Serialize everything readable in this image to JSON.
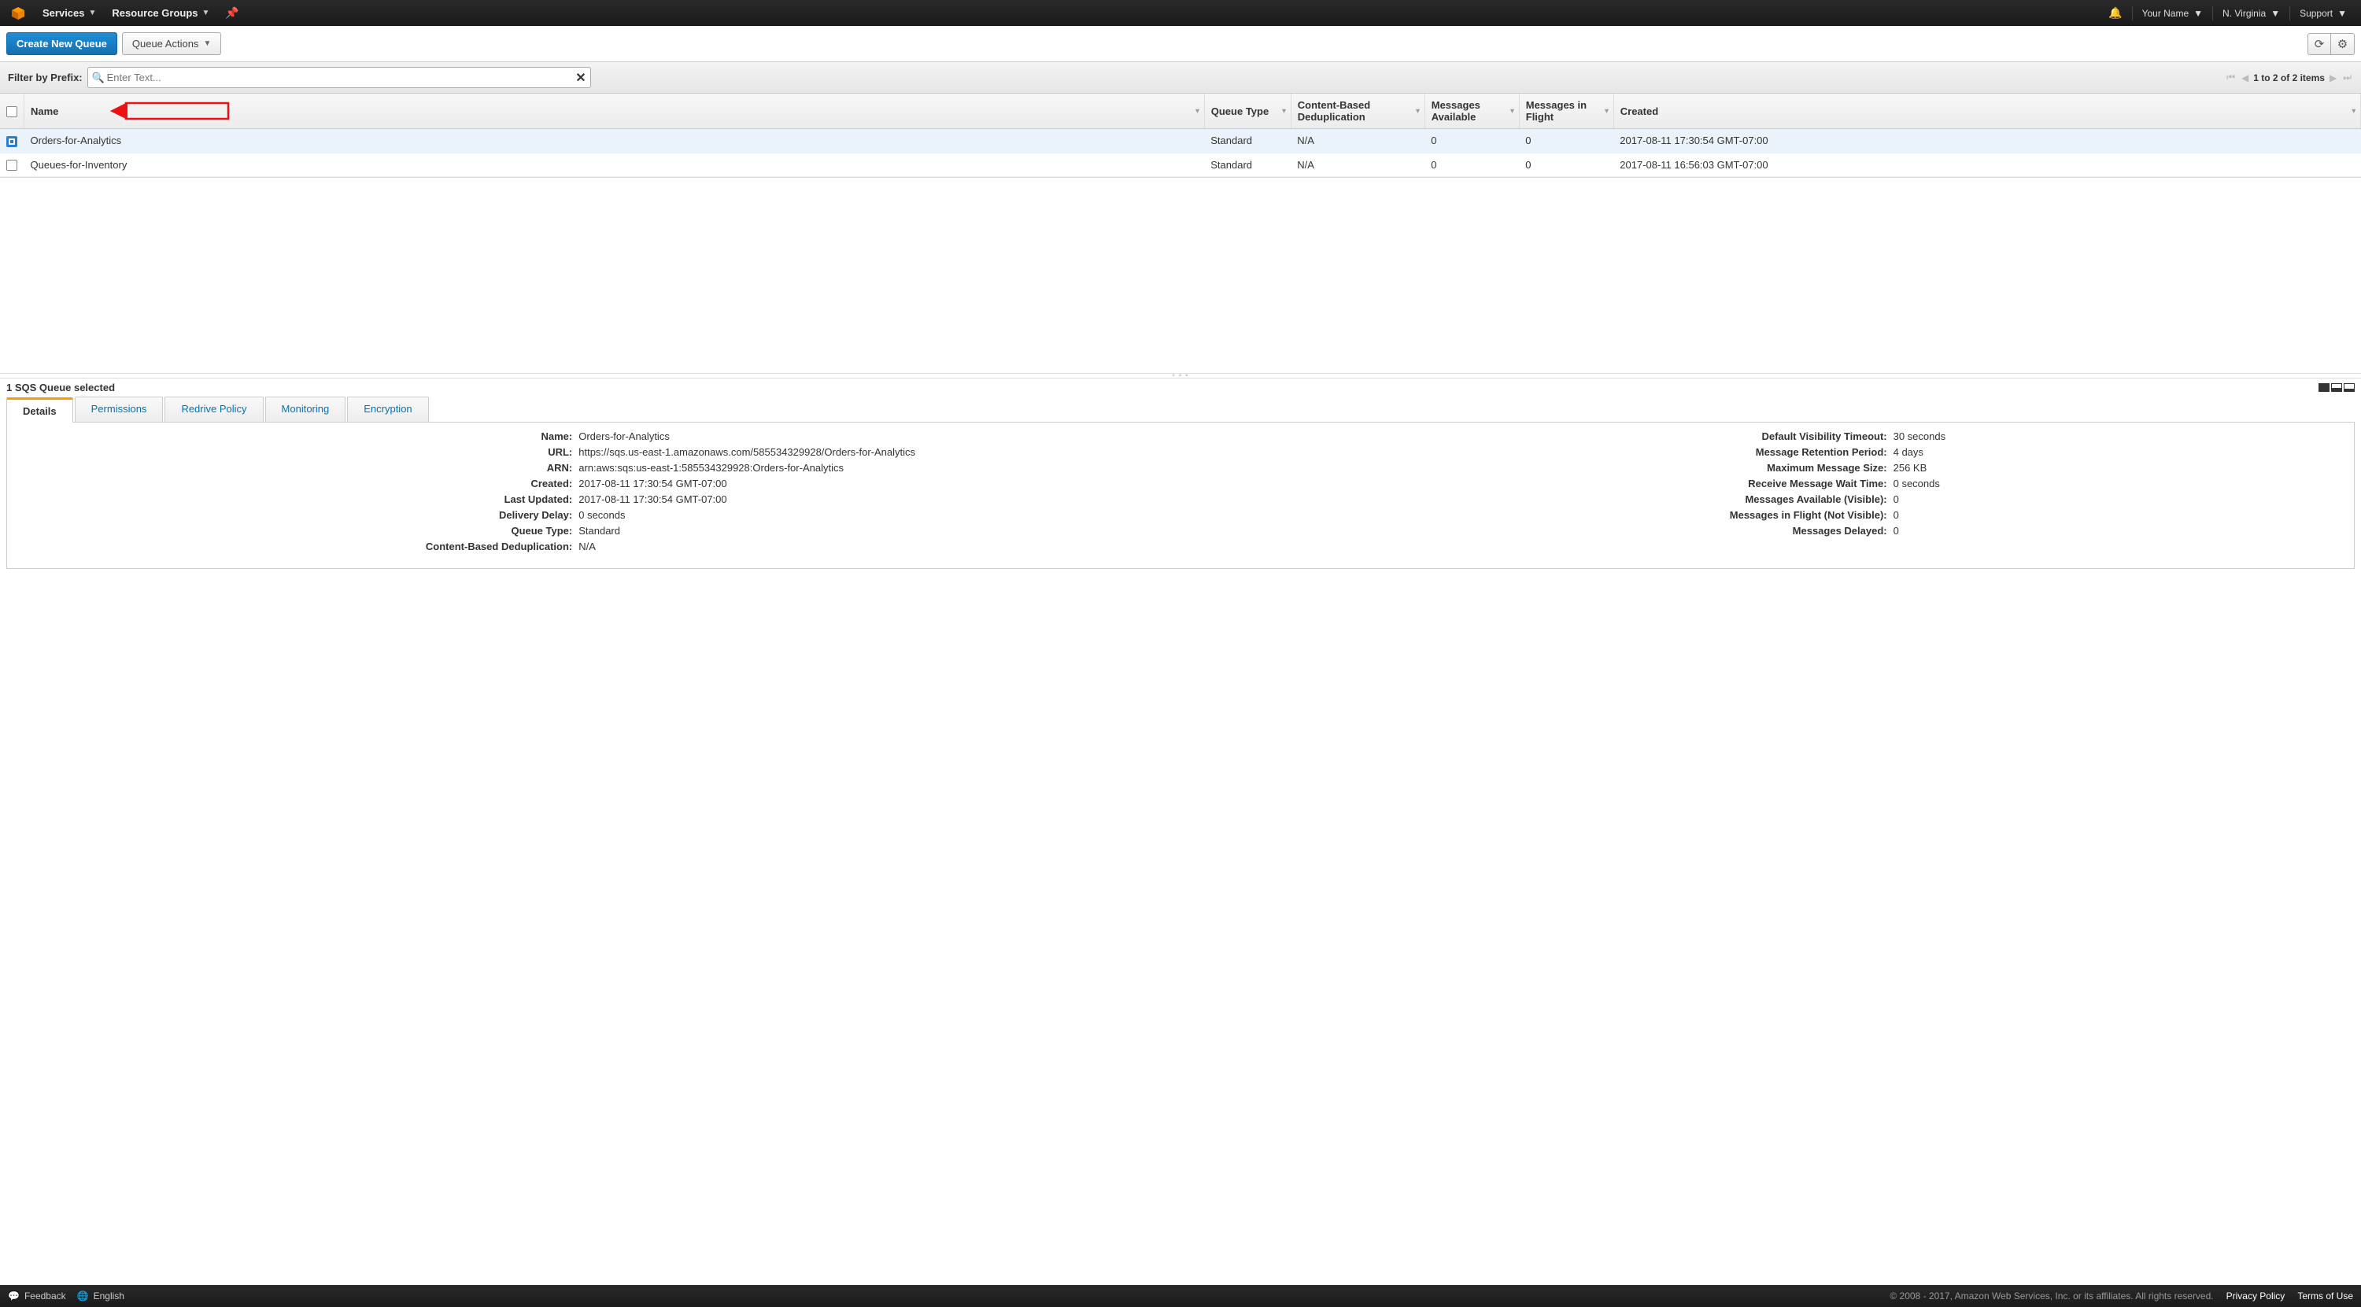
{
  "header": {
    "services": "Services",
    "resource_groups": "Resource Groups",
    "user_name": "Your Name",
    "region": "N. Virginia",
    "support": "Support"
  },
  "toolbar": {
    "create_queue": "Create New Queue",
    "queue_actions": "Queue Actions"
  },
  "filter": {
    "label": "Filter by Prefix:",
    "placeholder": "Enter Text...",
    "pagination": "1 to 2 of 2 items"
  },
  "table": {
    "headers": {
      "name": "Name",
      "queue_type": "Queue Type",
      "cbd": "Content-Based Deduplication",
      "msg_avail": "Messages Available",
      "msg_flight": "Messages in Flight",
      "created": "Created"
    },
    "rows": [
      {
        "selected": true,
        "name": "Orders-for-Analytics",
        "queue_type": "Standard",
        "cbd": "N/A",
        "msg_avail": "0",
        "msg_flight": "0",
        "created": "2017-08-11 17:30:54 GMT-07:00"
      },
      {
        "selected": false,
        "name": "Queues-for-Inventory",
        "queue_type": "Standard",
        "cbd": "N/A",
        "msg_avail": "0",
        "msg_flight": "0",
        "created": "2017-08-11 16:56:03 GMT-07:00"
      }
    ]
  },
  "selection": {
    "text": "1 SQS Queue selected"
  },
  "tabs": {
    "details": "Details",
    "permissions": "Permissions",
    "redrive": "Redrive Policy",
    "monitoring": "Monitoring",
    "encryption": "Encryption"
  },
  "details": {
    "left": {
      "name_k": "Name:",
      "name_v": "Orders-for-Analytics",
      "url_k": "URL:",
      "url_v": "https://sqs.us-east-1.amazonaws.com/585534329928/Orders-for-Analytics",
      "arn_k": "ARN:",
      "arn_v": "arn:aws:sqs:us-east-1:585534329928:Orders-for-Analytics",
      "created_k": "Created:",
      "created_v": "2017-08-11 17:30:54 GMT-07:00",
      "updated_k": "Last Updated:",
      "updated_v": "2017-08-11 17:30:54 GMT-07:00",
      "delay_k": "Delivery Delay:",
      "delay_v": "0 seconds",
      "type_k": "Queue Type:",
      "type_v": "Standard",
      "cbd_k": "Content-Based Deduplication:",
      "cbd_v": "N/A"
    },
    "right": {
      "vis_k": "Default Visibility Timeout:",
      "vis_v": "30 seconds",
      "ret_k": "Message Retention Period:",
      "ret_v": "4 days",
      "max_k": "Maximum Message Size:",
      "max_v": "256 KB",
      "wait_k": "Receive Message Wait Time:",
      "wait_v": "0 seconds",
      "avail_k": "Messages Available (Visible):",
      "avail_v": "0",
      "flight_k": "Messages in Flight (Not Visible):",
      "flight_v": "0",
      "delayed_k": "Messages Delayed:",
      "delayed_v": "0"
    }
  },
  "footer": {
    "feedback": "Feedback",
    "language": "English",
    "copyright": "© 2008 - 2017, Amazon Web Services, Inc. or its affiliates. All rights reserved.",
    "privacy": "Privacy Policy",
    "terms": "Terms of Use"
  }
}
